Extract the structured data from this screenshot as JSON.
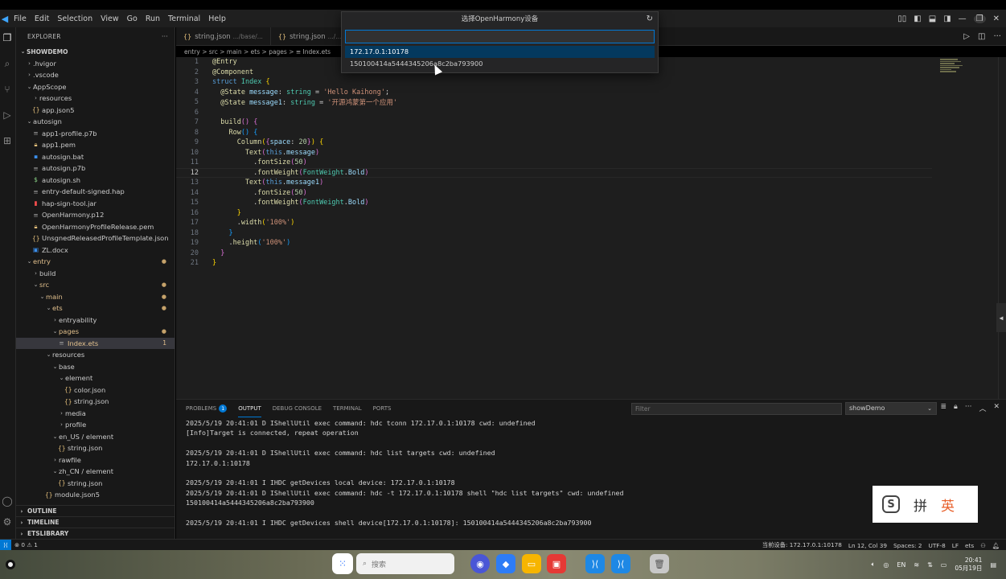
{
  "menubar": {
    "items": [
      "File",
      "Edit",
      "Selection",
      "View",
      "Go",
      "Run",
      "Terminal",
      "Help"
    ]
  },
  "sidebar": {
    "title": "EXPLORER",
    "more": "···",
    "tree": [
      {
        "label": "SHOWDEMO",
        "depth": 0,
        "type": "root",
        "chev": "v"
      },
      {
        "label": ".hvigor",
        "depth": 1,
        "type": "folder",
        "chev": ">"
      },
      {
        "label": ".vscode",
        "depth": 1,
        "type": "folder",
        "chev": ">"
      },
      {
        "label": "AppScope",
        "depth": 1,
        "type": "folder",
        "chev": "v"
      },
      {
        "label": "resources",
        "depth": 2,
        "type": "folder",
        "chev": ">"
      },
      {
        "label": "app.json5",
        "depth": 2,
        "type": "json"
      },
      {
        "label": "autosign",
        "depth": 1,
        "type": "folder",
        "chev": "v"
      },
      {
        "label": "app1-profile.p7b",
        "depth": 2,
        "type": "text"
      },
      {
        "label": "app1.pem",
        "depth": 2,
        "type": "pem"
      },
      {
        "label": "autosign.bat",
        "depth": 2,
        "type": "bat"
      },
      {
        "label": "autosign.p7b",
        "depth": 2,
        "type": "text"
      },
      {
        "label": "autosign.sh",
        "depth": 2,
        "type": "sh"
      },
      {
        "label": "entry-default-signed.hap",
        "depth": 2,
        "type": "text"
      },
      {
        "label": "hap-sign-tool.jar",
        "depth": 2,
        "type": "jar"
      },
      {
        "label": "OpenHarmony.p12",
        "depth": 2,
        "type": "text"
      },
      {
        "label": "OpenHarmonyProfileRelease.pem",
        "depth": 2,
        "type": "pem"
      },
      {
        "label": "UnsgnedReleasedProfileTemplate.json",
        "depth": 2,
        "type": "json"
      },
      {
        "label": "ZL.docx",
        "depth": 2,
        "type": "doc"
      },
      {
        "label": "entry",
        "depth": 1,
        "type": "folder-mod",
        "chev": "v",
        "dot": "●"
      },
      {
        "label": "build",
        "depth": 2,
        "type": "folder",
        "chev": ">"
      },
      {
        "label": "src",
        "depth": 2,
        "type": "folder-mod",
        "chev": "v",
        "dot": "●"
      },
      {
        "label": "main",
        "depth": 3,
        "type": "folder-mod",
        "chev": "v",
        "dot": "●"
      },
      {
        "label": "ets",
        "depth": 4,
        "type": "folder-mod",
        "chev": "v",
        "dot": "●"
      },
      {
        "label": "entryability",
        "depth": 5,
        "type": "folder",
        "chev": ">"
      },
      {
        "label": "pages",
        "depth": 5,
        "type": "folder-mod",
        "chev": "v",
        "dot": "●"
      },
      {
        "label": "Index.ets",
        "depth": 6,
        "type": "ets",
        "selected": true,
        "badge": "1"
      },
      {
        "label": "resources",
        "depth": 4,
        "type": "folder",
        "chev": "v"
      },
      {
        "label": "base",
        "depth": 5,
        "type": "folder",
        "chev": "v"
      },
      {
        "label": "element",
        "depth": 6,
        "type": "folder",
        "chev": "v"
      },
      {
        "label": "color.json",
        "depth": 7,
        "type": "json"
      },
      {
        "label": "string.json",
        "depth": 7,
        "type": "json"
      },
      {
        "label": "media",
        "depth": 6,
        "type": "folder",
        "chev": ">"
      },
      {
        "label": "profile",
        "depth": 6,
        "type": "folder",
        "chev": ">"
      },
      {
        "label": "en_US / element",
        "depth": 5,
        "type": "folder",
        "chev": "v"
      },
      {
        "label": "string.json",
        "depth": 6,
        "type": "json"
      },
      {
        "label": "rawfile",
        "depth": 5,
        "type": "folder",
        "chev": ">"
      },
      {
        "label": "zh_CN / element",
        "depth": 5,
        "type": "folder",
        "chev": "v"
      },
      {
        "label": "string.json",
        "depth": 6,
        "type": "json"
      },
      {
        "label": "module.json5",
        "depth": 4,
        "type": "json"
      }
    ],
    "sections": [
      "OUTLINE",
      "TIMELINE",
      "ETSLIBRARY"
    ]
  },
  "tabs": [
    {
      "icon": "{}",
      "name": "string.json",
      "path": ".../base/..."
    },
    {
      "icon": "{}",
      "name": "string.json",
      "path": ".../..."
    }
  ],
  "breadcrumb": "entry > src > main > ets > pages > ≡ Index.ets",
  "quickpick": {
    "title": "选择OpenHarmony设备",
    "input_value": "",
    "items": [
      "172.17.0.1:10178",
      "150100414a5444345206a8c2ba793900"
    ]
  },
  "editor": {
    "active_line": 12,
    "lines": [
      [
        {
          "t": "@Entry",
          "c": "dec"
        }
      ],
      [
        {
          "t": "@Component",
          "c": "dec"
        }
      ],
      [
        {
          "t": "struct ",
          "c": "kw2"
        },
        {
          "t": "Index",
          "c": "ty"
        },
        {
          "t": " {",
          "c": "b1"
        }
      ],
      [
        {
          "t": "  @State ",
          "c": "dec"
        },
        {
          "t": "message",
          "c": "prop"
        },
        {
          "t": ": ",
          "c": ""
        },
        {
          "t": "string",
          "c": "ty"
        },
        {
          "t": " = ",
          "c": ""
        },
        {
          "t": "'Hello Kaihong'",
          "c": "str"
        },
        {
          "t": ";",
          "c": ""
        }
      ],
      [
        {
          "t": "  @State ",
          "c": "dec"
        },
        {
          "t": "message1",
          "c": "prop"
        },
        {
          "t": ": ",
          "c": ""
        },
        {
          "t": "string",
          "c": "ty"
        },
        {
          "t": " = ",
          "c": ""
        },
        {
          "t": "'开源鸿蒙第一个应用'",
          "c": "str"
        }
      ],
      [
        {
          "t": "",
          "c": ""
        }
      ],
      [
        {
          "t": "  build",
          "c": "fn"
        },
        {
          "t": "() ",
          "c": "b2"
        },
        {
          "t": "{",
          "c": "b2"
        }
      ],
      [
        {
          "t": "    Row",
          "c": "fn"
        },
        {
          "t": "() ",
          "c": "b3"
        },
        {
          "t": "{",
          "c": "b3"
        }
      ],
      [
        {
          "t": "      Column",
          "c": "fn"
        },
        {
          "t": "(",
          "c": "b1"
        },
        {
          "t": "{",
          "c": "b2"
        },
        {
          "t": "space",
          "c": "prop"
        },
        {
          "t": ": ",
          "c": ""
        },
        {
          "t": "20",
          "c": "num"
        },
        {
          "t": "}",
          "c": "b2"
        },
        {
          "t": ")",
          "c": "b1"
        },
        {
          "t": " {",
          "c": "b1"
        }
      ],
      [
        {
          "t": "        Text",
          "c": "fn"
        },
        {
          "t": "(",
          "c": "b2"
        },
        {
          "t": "this",
          "c": "kw2"
        },
        {
          "t": ".",
          "c": ""
        },
        {
          "t": "message",
          "c": "prop"
        },
        {
          "t": ")",
          "c": "b2"
        }
      ],
      [
        {
          "t": "          .",
          "c": ""
        },
        {
          "t": "fontSize",
          "c": "fn"
        },
        {
          "t": "(",
          "c": "b2"
        },
        {
          "t": "50",
          "c": "num"
        },
        {
          "t": ")",
          "c": "b2"
        }
      ],
      [
        {
          "t": "          .",
          "c": ""
        },
        {
          "t": "fontWeight",
          "c": "fn"
        },
        {
          "t": "(",
          "c": "b2"
        },
        {
          "t": "FontWeight",
          "c": "ty"
        },
        {
          "t": ".",
          "c": ""
        },
        {
          "t": "Bold",
          "c": "prop"
        },
        {
          "t": ")",
          "c": "b2"
        }
      ],
      [
        {
          "t": "        Text",
          "c": "fn"
        },
        {
          "t": "(",
          "c": "b2"
        },
        {
          "t": "this",
          "c": "kw2"
        },
        {
          "t": ".",
          "c": ""
        },
        {
          "t": "message1",
          "c": "prop"
        },
        {
          "t": ")",
          "c": "b2"
        }
      ],
      [
        {
          "t": "          .",
          "c": ""
        },
        {
          "t": "fontSize",
          "c": "fn"
        },
        {
          "t": "(",
          "c": "b2"
        },
        {
          "t": "50",
          "c": "num"
        },
        {
          "t": ")",
          "c": "b2"
        }
      ],
      [
        {
          "t": "          .",
          "c": ""
        },
        {
          "t": "fontWeight",
          "c": "fn"
        },
        {
          "t": "(",
          "c": "b2"
        },
        {
          "t": "FontWeight",
          "c": "ty"
        },
        {
          "t": ".",
          "c": ""
        },
        {
          "t": "Bold",
          "c": "prop"
        },
        {
          "t": ")",
          "c": "b2"
        }
      ],
      [
        {
          "t": "      }",
          "c": "b1"
        }
      ],
      [
        {
          "t": "      .",
          "c": ""
        },
        {
          "t": "width",
          "c": "fn"
        },
        {
          "t": "(",
          "c": "b1"
        },
        {
          "t": "'100%'",
          "c": "str"
        },
        {
          "t": ")",
          "c": "b1"
        }
      ],
      [
        {
          "t": "    }",
          "c": "b3"
        }
      ],
      [
        {
          "t": "    .",
          "c": ""
        },
        {
          "t": "height",
          "c": "fn"
        },
        {
          "t": "(",
          "c": "b3"
        },
        {
          "t": "'100%'",
          "c": "str"
        },
        {
          "t": ")",
          "c": "b3"
        }
      ],
      [
        {
          "t": "  }",
          "c": "b2"
        }
      ],
      [
        {
          "t": "}",
          "c": "b1"
        }
      ]
    ]
  },
  "panel": {
    "tabs": [
      {
        "label": "PROBLEMS",
        "badge": "1"
      },
      {
        "label": "OUTPUT",
        "active": true
      },
      {
        "label": "DEBUG CONSOLE"
      },
      {
        "label": "TERMINAL"
      },
      {
        "label": "PORTS"
      }
    ],
    "filter_placeholder": "Filter",
    "channel": "showDemo",
    "output_lines": [
      "2025/5/19 20:41:01 D IShellUtil exec command: hdc tconn 172.17.0.1:10178 cwd: undefined",
      "[Info]Target is connected, repeat operation",
      "",
      "2025/5/19 20:41:01 D IShellUtil exec command: hdc list targets cwd: undefined",
      "172.17.0.1:10178",
      "",
      "2025/5/19 20:41:01 I IHDC getDevices local device: 172.17.0.1:10178",
      "2025/5/19 20:41:01 D IShellUtil exec command: hdc -t 172.17.0.1:10178 shell \"hdc list targets\" cwd: undefined",
      "150100414a5444345206a8c2ba793900",
      "",
      "2025/5/19 20:41:01 I IHDC getDevices shell device[172.17.0.1:10178]: 150100414a5444345206a8c2ba793900"
    ]
  },
  "statusbar": {
    "problems": "⊗ 0 ⚠ 1",
    "device": "当前设备: 172.17.0.1:10178",
    "position": "Ln 12, Col 39",
    "spaces": "Spaces: 2",
    "encoding": "UTF-8",
    "eol": "LF",
    "language": "ets"
  },
  "ime": {
    "pin": "拼",
    "ying": "英",
    "logo": "S"
  },
  "taskbar": {
    "search_placeholder": "搜索",
    "lang": "EN",
    "time": "20:41",
    "date": "05月19日"
  }
}
